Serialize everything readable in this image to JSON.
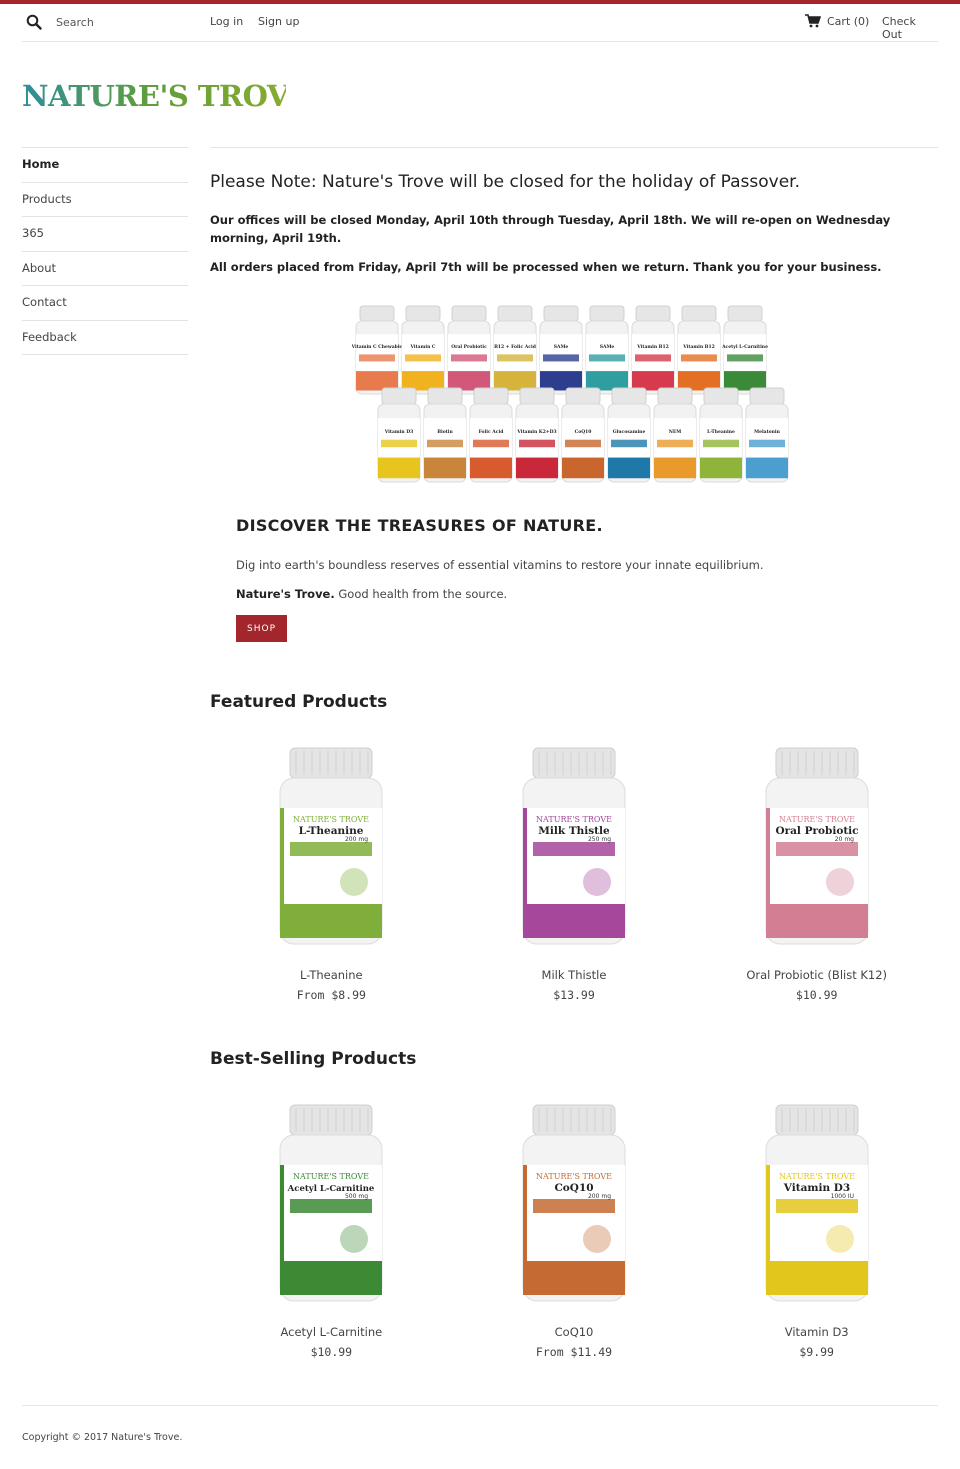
{
  "header": {
    "search_placeholder": "Search",
    "login": "Log in",
    "signup": "Sign up",
    "cart": "Cart (0)",
    "checkout": "Check Out"
  },
  "logo": {
    "text": "NATURE'S TROVE"
  },
  "sidebar": {
    "items": [
      {
        "label": "Home",
        "active": true
      },
      {
        "label": "Products"
      },
      {
        "label": "365"
      },
      {
        "label": "About"
      },
      {
        "label": "Contact"
      },
      {
        "label": "Feedback"
      }
    ]
  },
  "notice": {
    "title": "Please Note: Nature's Trove will be closed for the holiday of Passover.",
    "line1": "Our offices will be closed Monday, April 10th through Tuesday, April 18th. We will re-open on Wednesday morning, April 19th.",
    "line2": "All orders placed from Friday, April 7th will be processed when we return. Thank you for your business."
  },
  "banner": {
    "row1": [
      "Vitamin C Chewable",
      "Vitamin C",
      "Oral Probiotic",
      "B12 + Folic Acid",
      "SAMe",
      "SAMe",
      "Vitamin B12",
      "Vitamin B12",
      "Acetyl L-Carnitine"
    ],
    "row2": [
      "Vitamin D3",
      "Biotin",
      "Folic Acid",
      "Vitamin K2+D3",
      "CoQ10",
      "Glucosamine",
      "NEM",
      "L-Theanine",
      "Melatonin"
    ]
  },
  "discover": {
    "title": "DISCOVER THE TREASURES OF NATURE.",
    "text": "Dig into earth's boundless reserves of essential vitamins to restore your innate equilibrium.",
    "brand": "Nature's Trove.",
    "tagline": "Good health from the source.",
    "shop": "SHOP"
  },
  "featured": {
    "title": "Featured Products",
    "products": [
      {
        "name": "L-Theanine",
        "price": "From $8.99",
        "label": "L-Theanine",
        "dose": "200 mg",
        "color": "#7fae3a"
      },
      {
        "name": "Milk Thistle",
        "price": "$13.99",
        "label": "Milk Thistle",
        "dose": "250 mg",
        "color": "#a5479a"
      },
      {
        "name": "Oral Probiotic (Blist K12)",
        "price": "$10.99",
        "label": "Oral Probiotic",
        "dose": "20 mg",
        "color": "#d27f93"
      }
    ]
  },
  "bestselling": {
    "title": "Best-Selling Products",
    "products": [
      {
        "name": "Acetyl L-Carnitine",
        "price": "$10.99",
        "label": "Acetyl L-Carnitine",
        "dose": "500 mg",
        "color": "#3c8a34"
      },
      {
        "name": "CoQ10",
        "price": "From $11.49",
        "label": "CoQ10",
        "dose": "200 mg",
        "color": "#c46a32"
      },
      {
        "name": "Vitamin D3",
        "price": "$9.99",
        "label": "Vitamin D3",
        "dose": "1000 IU",
        "color": "#e2c61c"
      }
    ]
  },
  "footer": {
    "copyright": "Copyright © 2017 Nature's Trove."
  },
  "colors": {
    "accent": "#a3262c"
  }
}
